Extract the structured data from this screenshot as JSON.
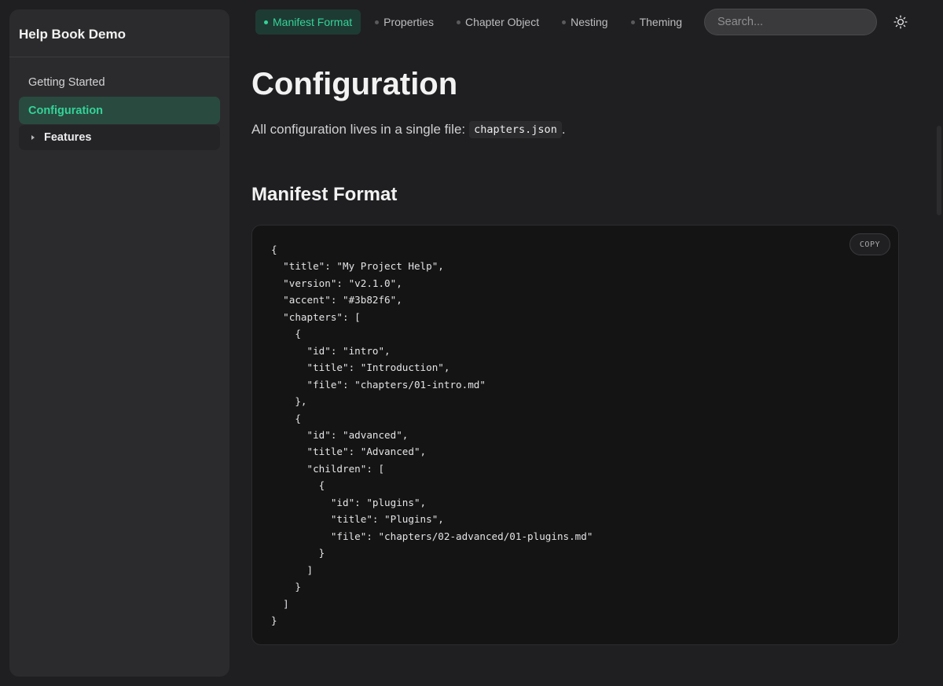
{
  "sidebar": {
    "title": "Help Book Demo",
    "items": [
      {
        "label": "Getting Started"
      },
      {
        "label": "Configuration"
      },
      {
        "label": "Features"
      }
    ]
  },
  "tabs": [
    {
      "label": "Manifest Format"
    },
    {
      "label": "Properties"
    },
    {
      "label": "Chapter Object"
    },
    {
      "label": "Nesting"
    },
    {
      "label": "Theming"
    }
  ],
  "search": {
    "placeholder": "Search..."
  },
  "theme_toggle": {
    "icon": "sun-icon"
  },
  "page": {
    "title": "Configuration",
    "intro_text": "All configuration lives in a single file:",
    "intro_code": "chapters.json",
    "intro_end": ".",
    "section_title": "Manifest Format",
    "copy_label": "COPY",
    "code": "{\n  \"title\": \"My Project Help\",\n  \"version\": \"v2.1.0\",\n  \"accent\": \"#3b82f6\",\n  \"chapters\": [\n    {\n      \"id\": \"intro\",\n      \"title\": \"Introduction\",\n      \"file\": \"chapters/01-intro.md\"\n    },\n    {\n      \"id\": \"advanced\",\n      \"title\": \"Advanced\",\n      \"children\": [\n        {\n          \"id\": \"plugins\",\n          \"title\": \"Plugins\",\n          \"file\": \"chapters/02-advanced/01-plugins.md\"\n        }\n      ]\n    }\n  ]\n}"
  },
  "colors": {
    "accent": "#34d399",
    "background": "#1f1f21",
    "sidebar": "#2b2b2d",
    "code_background": "#141415"
  }
}
